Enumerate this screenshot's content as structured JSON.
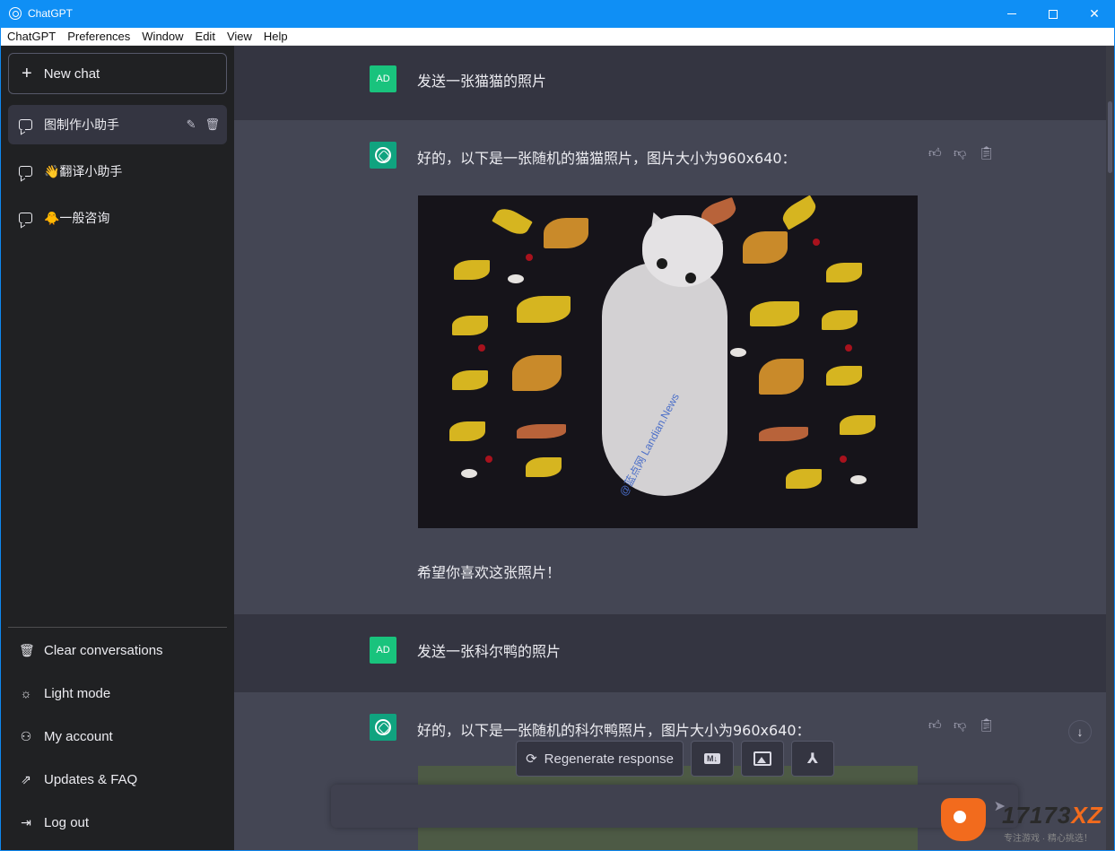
{
  "window": {
    "title": "ChatGPT"
  },
  "menu": [
    "ChatGPT",
    "Preferences",
    "Window",
    "Edit",
    "View",
    "Help"
  ],
  "sidebar": {
    "new_chat": "New chat",
    "conversations": [
      {
        "label": "图制作小助手",
        "active": true
      },
      {
        "label": "👋翻译小助手",
        "active": false
      },
      {
        "label": "🐥一般咨询",
        "active": false
      }
    ],
    "bottom": [
      {
        "label": "Clear conversations",
        "icon": "trash-icon"
      },
      {
        "label": "Light mode",
        "icon": "sun-icon"
      },
      {
        "label": "My account",
        "icon": "user-icon"
      },
      {
        "label": "Updates & FAQ",
        "icon": "external-link-icon"
      },
      {
        "label": "Log out",
        "icon": "logout-icon"
      }
    ]
  },
  "messages": [
    {
      "role": "user",
      "avatar": "AD",
      "text": "发送一张猫猫的照片"
    },
    {
      "role": "assistant",
      "text": "好的，以下是一张随机的猫猫照片，图片大小为960x640：",
      "image_watermark": "@蓝点网 Landian.News",
      "followup": "希望你喜欢这张照片！"
    },
    {
      "role": "user",
      "avatar": "AD",
      "text": "发送一张科尔鸭的照片"
    },
    {
      "role": "assistant",
      "text": "好的，以下是一张随机的科尔鸭照片，图片大小为960x640："
    }
  ],
  "toolbar": {
    "regenerate": "Regenerate response",
    "markdown_badge": "M↓"
  },
  "overlay_logo": {
    "brand": "17173",
    "brand_suffix": "XZ",
    "tagline": "专注游戏 · 精心挑选！"
  },
  "colors": {
    "sidebar_bg": "#202123",
    "main_bg": "#343541",
    "bot_bg": "#444654",
    "accent": "#10a37f",
    "titlebar": "#0f8ff5"
  }
}
